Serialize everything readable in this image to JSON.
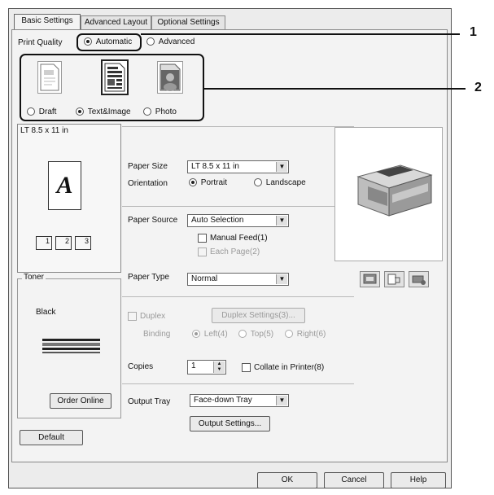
{
  "tabs": [
    "Basic Settings",
    "Advanced Layout",
    "Optional Settings"
  ],
  "print_quality": {
    "label": "Print Quality",
    "automatic": "Automatic",
    "advanced": "Advanced",
    "selected": "Automatic"
  },
  "quality_modes": {
    "draft": "Draft",
    "text_image": "Text&Image",
    "photo": "Photo",
    "selected": "Text&Image"
  },
  "preview": {
    "paper_label": "LT 8.5 x 11 in",
    "letter": "A",
    "copy_icons": [
      "1",
      "2",
      "3"
    ]
  },
  "paper_size": {
    "label": "Paper Size",
    "value": "LT 8.5 x 11 in"
  },
  "orientation": {
    "label": "Orientation",
    "portrait": "Portrait",
    "landscape": "Landscape",
    "selected": "Portrait"
  },
  "paper_source": {
    "label": "Paper Source",
    "value": "Auto Selection",
    "manual_feed": "Manual Feed(1)",
    "each_page": "Each Page(2)"
  },
  "paper_type": {
    "label": "Paper Type",
    "value": "Normal"
  },
  "duplex": {
    "label": "Duplex",
    "settings_button": "Duplex Settings(3)...",
    "binding_label": "Binding",
    "left": "Left(4)",
    "top": "Top(5)",
    "right": "Right(6)"
  },
  "copies": {
    "label": "Copies",
    "value": "1",
    "collate": "Collate in Printer(8)"
  },
  "output_tray": {
    "label": "Output Tray",
    "value": "Face-down Tray",
    "settings_button": "Output Settings..."
  },
  "toner": {
    "title": "Toner",
    "color": "Black",
    "order_button": "Order Online"
  },
  "default_button": "Default",
  "footer": {
    "ok": "OK",
    "cancel": "Cancel",
    "help": "Help"
  },
  "callouts": [
    "1",
    "2"
  ]
}
